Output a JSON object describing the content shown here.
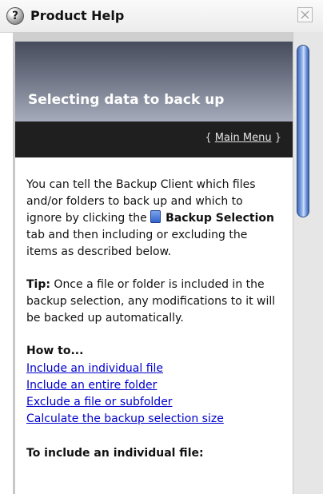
{
  "window": {
    "title": "Product Help",
    "help_icon_glyph": "?",
    "close_icon": "close-icon"
  },
  "header": {
    "title": "Selecting data to back up"
  },
  "nav": {
    "open_brace": "{ ",
    "main_menu": "Main Menu",
    "close_brace": " }"
  },
  "content": {
    "intro_part1": "You can tell the Backup Client which files and/or folders to back up and which to ignore by clicking the ",
    "intro_tab_label": "Backup Selection",
    "intro_part2": " tab and then including or excluding the items as described below.",
    "tip_label": "Tip:",
    "tip_text": " Once a file or folder is included in the backup selection, any modifications to it will be backed up automatically.",
    "howto_heading": "How to...",
    "links": [
      "Include an individual file",
      "Include an entire folder",
      "Exclude a file or subfolder",
      "Calculate the backup selection size"
    ],
    "section_heading": "To include an individual file:"
  },
  "colors": {
    "link": "#0000cc",
    "header_top": "#474c5c",
    "navbar": "#1f1f1f",
    "scroll_thumb": "#6c93d8"
  }
}
